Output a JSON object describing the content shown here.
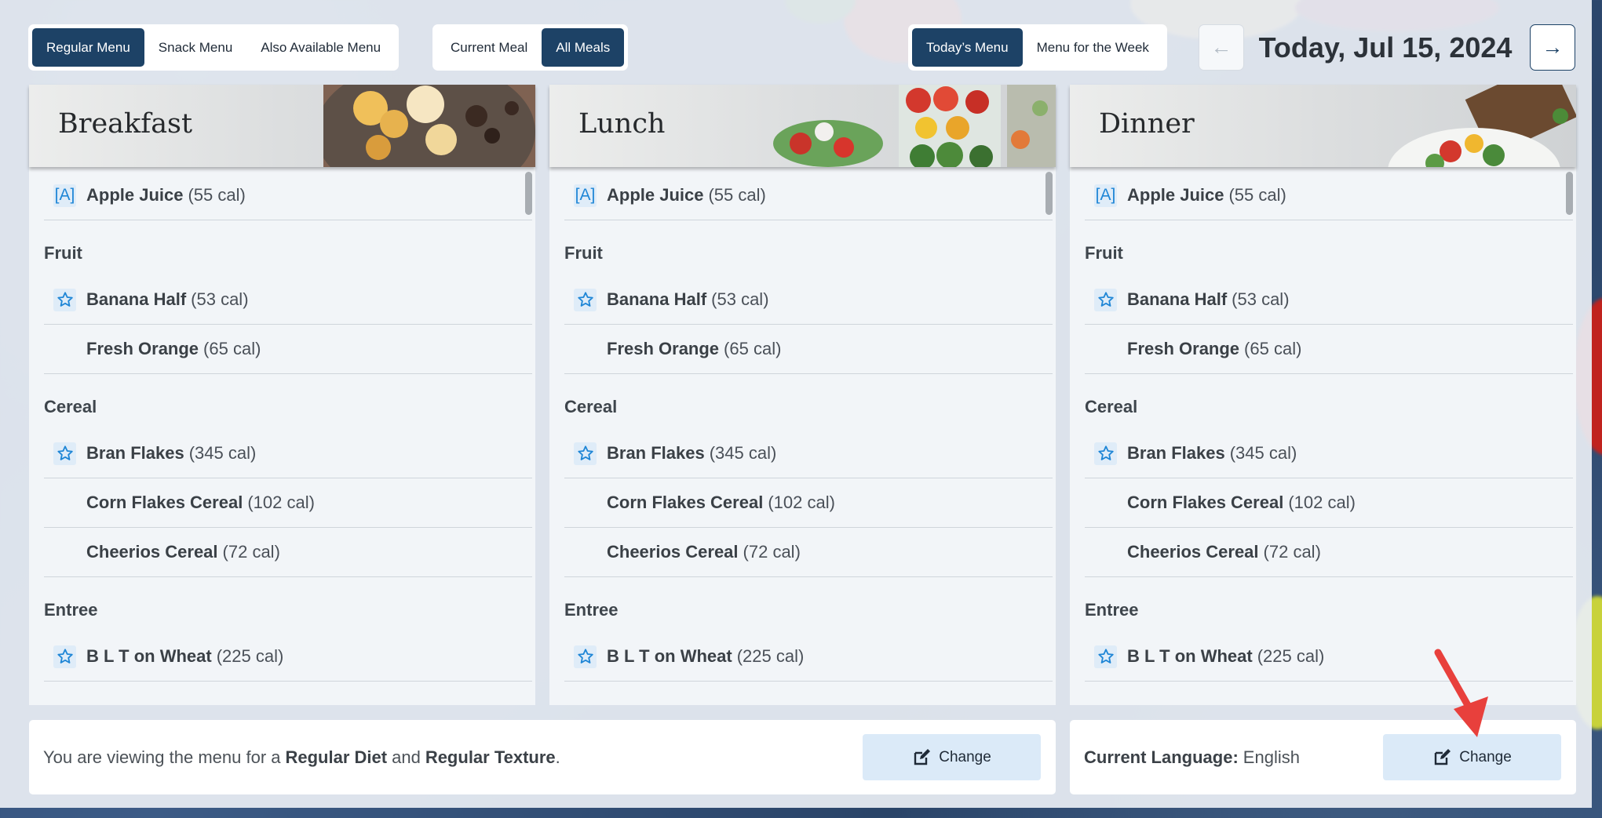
{
  "tabs_menu": [
    "Regular Menu",
    "Snack Menu",
    "Also Available Menu"
  ],
  "tabs_meal": [
    "Current Meal",
    "All Meals"
  ],
  "tabs_range": [
    "Today’s Menu",
    "Menu for the Week"
  ],
  "date_nav": {
    "prev_icon": "arrow-left-icon",
    "next_icon": "arrow-right-icon",
    "date": "Today, Jul 15, 2024"
  },
  "meals": [
    {
      "title": "Breakfast"
    },
    {
      "title": "Lunch"
    },
    {
      "title": "Dinner"
    }
  ],
  "menu": {
    "top_item": {
      "badge": "[A]",
      "name": "Apple Juice",
      "cal": "(55 cal)"
    },
    "categories": [
      {
        "name": "Fruit",
        "items": [
          {
            "fav": true,
            "name": "Banana Half",
            "cal": "(53 cal)"
          },
          {
            "fav": false,
            "name": "Fresh Orange",
            "cal": "(65 cal)"
          }
        ]
      },
      {
        "name": "Cereal",
        "items": [
          {
            "fav": true,
            "name": "Bran Flakes",
            "cal": "(345 cal)"
          },
          {
            "fav": false,
            "name": "Corn Flakes Cereal",
            "cal": "(102 cal)"
          },
          {
            "fav": false,
            "name": "Cheerios Cereal",
            "cal": "(72 cal)"
          }
        ]
      },
      {
        "name": "Entree",
        "items": [
          {
            "fav": true,
            "name": "B L T on Wheat",
            "cal": "(225 cal)"
          }
        ]
      }
    ]
  },
  "diet": {
    "prefix": "You are viewing the menu for a",
    "diet": "Regular Diet",
    "and": "and",
    "texture": "Regular Texture",
    "suffix": ".",
    "button": "Change"
  },
  "language": {
    "label": "Current Language:",
    "value": "English",
    "button": "Change"
  },
  "colors": {
    "accent": "#1d4266",
    "icon": "#1f86d6",
    "button_bg": "#dbeaf8",
    "annotation_arrow": "#e8403c"
  }
}
